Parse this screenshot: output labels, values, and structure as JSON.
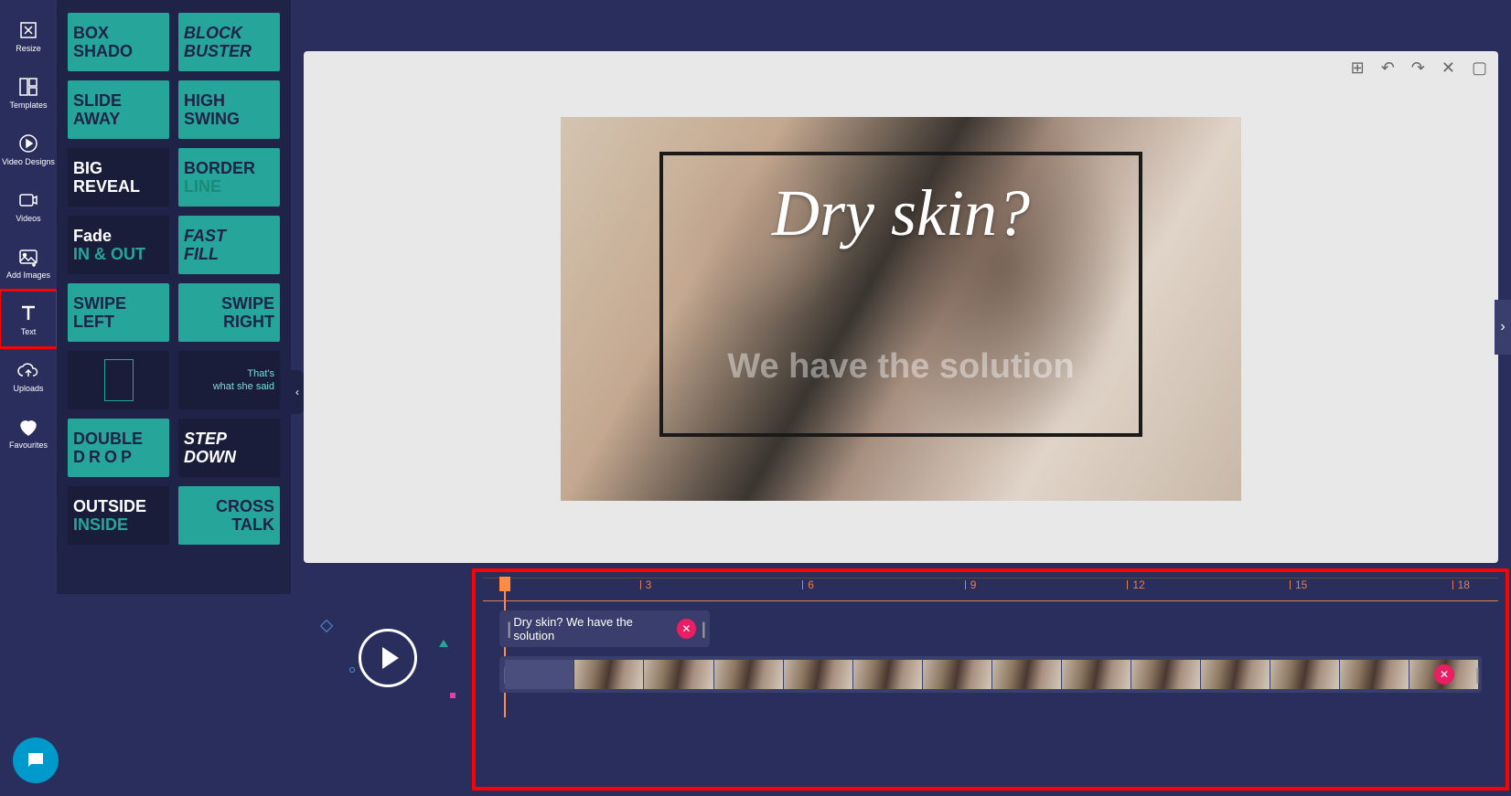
{
  "sidebar": {
    "items": [
      {
        "label": "Resize"
      },
      {
        "label": "Templates"
      },
      {
        "label": "Video Designs"
      },
      {
        "label": "Videos"
      },
      {
        "label": "Add Images"
      },
      {
        "label": "Text"
      },
      {
        "label": "Uploads"
      },
      {
        "label": "Favourites"
      }
    ]
  },
  "text_styles": [
    {
      "l1": "BOX",
      "l2": "SHADO",
      "style": "teal"
    },
    {
      "l1": "BLOCK",
      "l2": "BUSTER",
      "style": "teal",
      "italic": true
    },
    {
      "l1": "SLIDE",
      "l2": "AWAY",
      "style": "teal"
    },
    {
      "l1": "HIGH",
      "l2": "SWING",
      "style": "teal"
    },
    {
      "l1": "BIG",
      "l2": "REVEAL",
      "style": "dark"
    },
    {
      "l1": "BORDER",
      "l2": "LINE",
      "style": "teal",
      "l2color": "#1a8a7a"
    },
    {
      "l1": "Fade",
      "l2": "IN & OUT",
      "style": "dark",
      "l2teal": true
    },
    {
      "l1": "FAST",
      "l2": "FILL",
      "style": "teal",
      "italic": true
    },
    {
      "l1": "SWIPE",
      "l2": "LEFT",
      "style": "teal"
    },
    {
      "l1": "SWIPE",
      "l2": "RIGHT",
      "style": "teal",
      "align": "right"
    },
    {
      "l1": "",
      "l2": "",
      "style": "dark",
      "frame": true
    },
    {
      "l1": "That's",
      "l2": "what she said",
      "style": "dark",
      "small": true
    },
    {
      "l1": "DOUBLE",
      "l2": "DROP",
      "style": "teal",
      "wide": true
    },
    {
      "l1": "STEP",
      "l2": "DOWN",
      "style": "dark",
      "italic": true
    },
    {
      "l1": "OUTSIDE",
      "l2": "INSIDE",
      "style": "dark",
      "l2teal": true
    },
    {
      "l1": "CROSS",
      "l2": "TALK",
      "style": "teal",
      "align": "right"
    }
  ],
  "canvas": {
    "text1": "Dry skin?",
    "text2": "We have the solution"
  },
  "timeline": {
    "ticks": [
      "3",
      "6",
      "9",
      "12",
      "15",
      "18"
    ],
    "text_clip": "Dry skin? We have the solution"
  }
}
